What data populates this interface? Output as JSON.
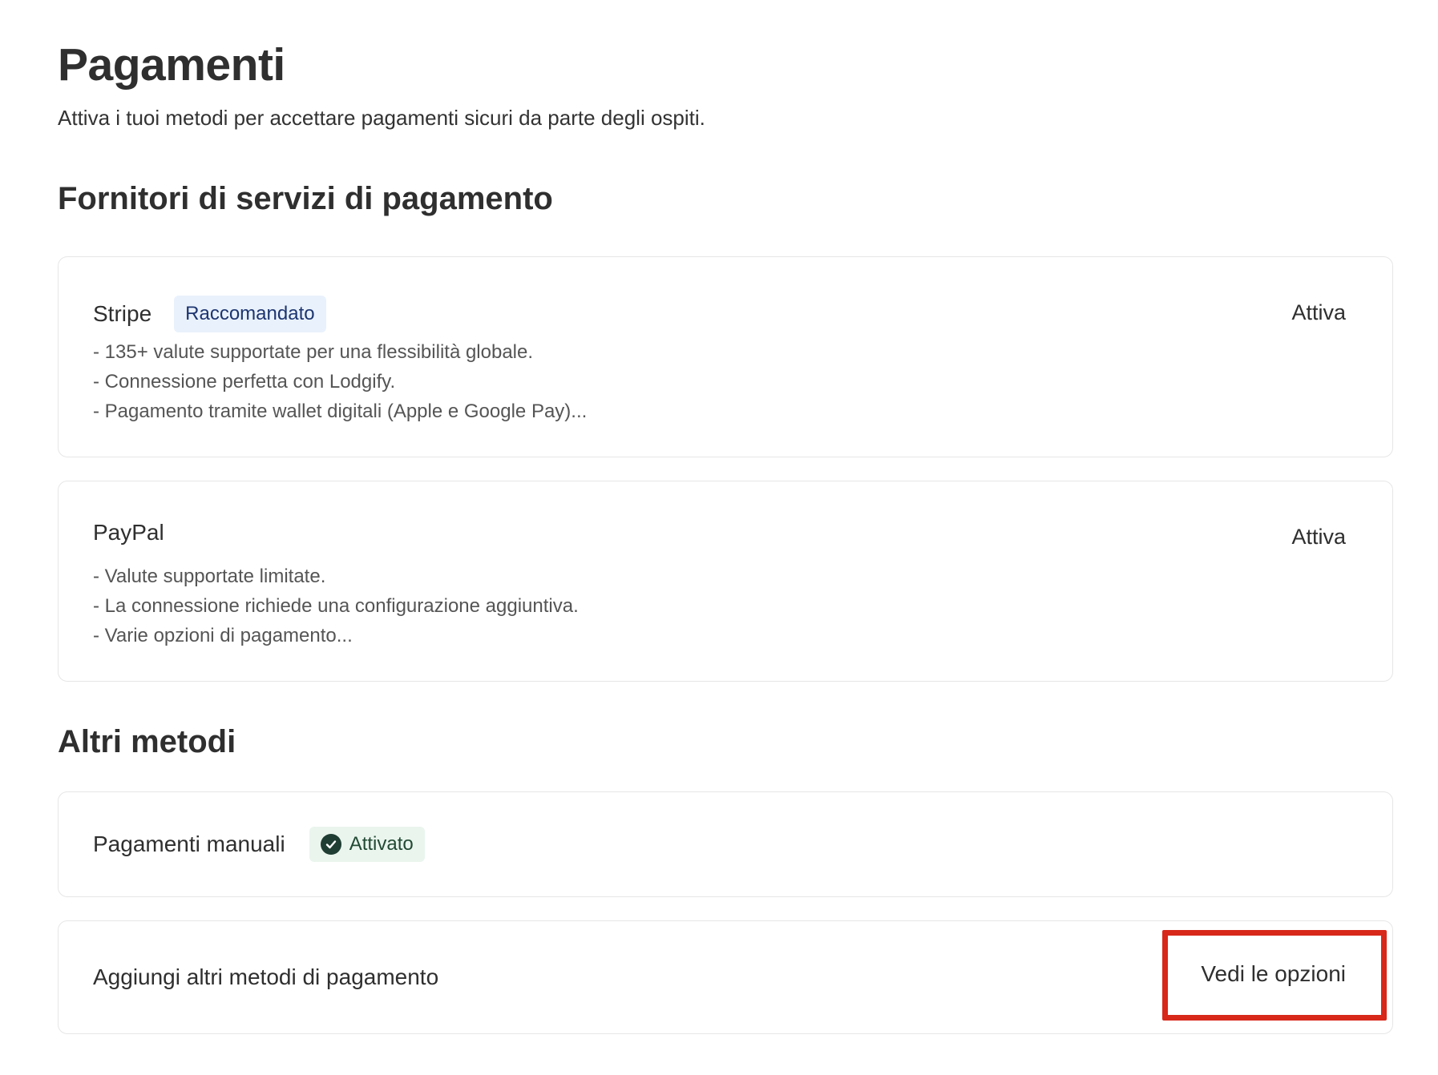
{
  "header": {
    "title": "Pagamenti",
    "subtitle": "Attiva i tuoi metodi per accettare pagamenti sicuri da parte degli ospiti."
  },
  "psp_section": {
    "title": "Fornitori di servizi di pagamento",
    "providers": [
      {
        "name": "Stripe",
        "badge": "Raccomandato",
        "features": [
          "- 135+ valute supportate per una flessibilità globale.",
          "- Connessione perfetta con Lodgify.",
          "- Pagamento tramite wallet digitali (Apple e Google Pay)..."
        ],
        "action": "Attiva"
      },
      {
        "name": "PayPal",
        "features": [
          "- Valute supportate limitate.",
          "- La connessione richiede una configurazione aggiuntiva.",
          "- Varie opzioni di pagamento..."
        ],
        "action": "Attiva"
      }
    ]
  },
  "other_section": {
    "title": "Altri metodi",
    "manual": {
      "name": "Pagamenti manuali",
      "status": "Attivato",
      "status_icon": "check-circle-icon"
    },
    "add_more": {
      "label": "Aggiungi altri metodi di pagamento",
      "action": "Vedi le opzioni"
    }
  },
  "colors": {
    "accent_badge_bg": "#e9f1fc",
    "success_badge_bg": "#eaf5ee",
    "highlight": "#d7281a"
  }
}
